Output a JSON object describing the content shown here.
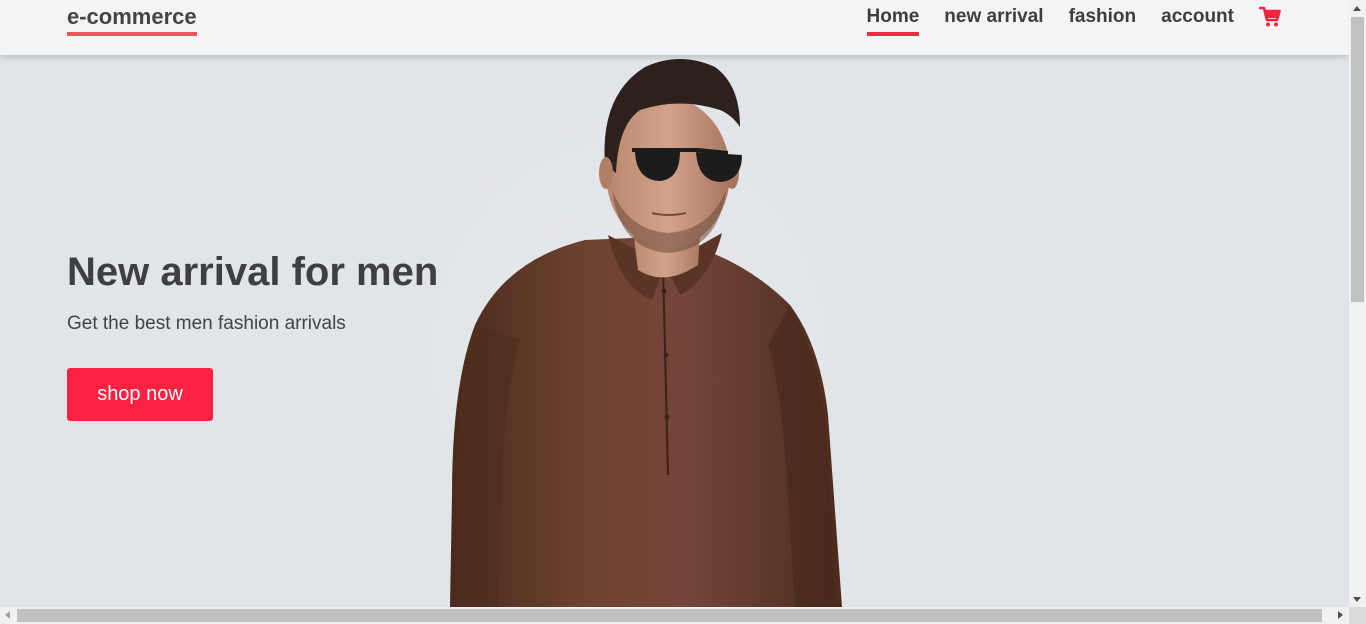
{
  "brand": {
    "name": "e-commerce"
  },
  "nav": {
    "items": [
      {
        "label": "Home",
        "active": true
      },
      {
        "label": "new arrival",
        "active": false
      },
      {
        "label": "fashion",
        "active": false
      },
      {
        "label": "account",
        "active": false
      }
    ],
    "cart_icon": "shopping-cart-icon"
  },
  "hero": {
    "title": "New arrival for men",
    "subtitle": "Get the best men fashion arrivals",
    "cta_label": "shop now"
  },
  "colors": {
    "accent": "#fb2241",
    "underline": "#ee2a44",
    "text": "#3f3f3f",
    "background": "#e1e4e8",
    "shirt": "#6b3f2a"
  }
}
